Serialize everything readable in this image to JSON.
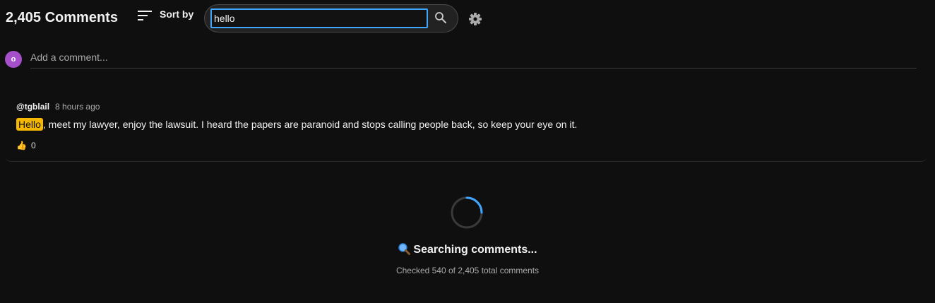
{
  "header": {
    "comment_count": "2,405 Comments",
    "sort_label": "Sort by",
    "sort_icon": "sort-icon",
    "search_value": "hello",
    "search_icon": "search-icon",
    "settings_icon": "gear-icon"
  },
  "add_comment": {
    "avatar_letter": "o",
    "avatar_color": "#a54fc9",
    "placeholder": "Add a comment..."
  },
  "comments": [
    {
      "author": "@tgblail",
      "time": "8 hours ago",
      "highlight": "Hello",
      "text_rest": ", meet my lawyer, enjoy the lawsuit. I heard the papers are paranoid and stops calling people back, so keep your eye on it.",
      "like_icon": "thumbs-up-icon",
      "likes": "0"
    }
  ],
  "loading": {
    "status": "Searching comments...",
    "status_icon": "magnifier-icon",
    "progress": "Checked 540 of 2,405 total comments"
  },
  "colors": {
    "background": "#0f0f0f",
    "accent": "#3ea6ff",
    "highlight": "#f5b700"
  }
}
